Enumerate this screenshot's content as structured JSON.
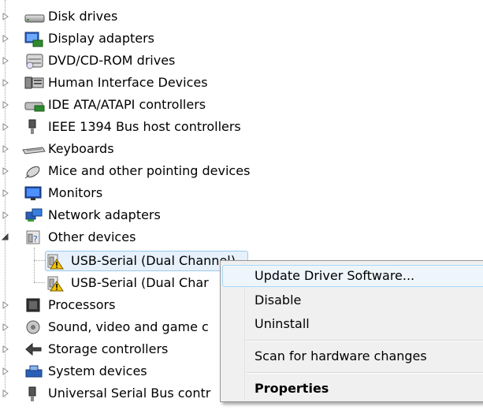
{
  "tree": {
    "items": [
      {
        "label": "Disk drives",
        "icon": "disk-drive-icon"
      },
      {
        "label": "Display adapters",
        "icon": "display-adapter-icon"
      },
      {
        "label": "DVD/CD-ROM drives",
        "icon": "dvd-drive-icon"
      },
      {
        "label": "Human Interface Devices",
        "icon": "hid-icon"
      },
      {
        "label": "IDE ATA/ATAPI controllers",
        "icon": "ide-controller-icon"
      },
      {
        "label": "IEEE 1394 Bus host controllers",
        "icon": "ieee1394-icon"
      },
      {
        "label": "Keyboards",
        "icon": "keyboard-icon"
      },
      {
        "label": "Mice and other pointing devices",
        "icon": "mouse-icon"
      },
      {
        "label": "Monitors",
        "icon": "monitor-icon"
      },
      {
        "label": "Network adapters",
        "icon": "network-adapter-icon"
      },
      {
        "label": "Other devices",
        "icon": "other-devices-icon"
      },
      {
        "label": "Processors",
        "icon": "processor-icon"
      },
      {
        "label": "Sound, video and game c",
        "icon": "sound-icon"
      },
      {
        "label": "Storage controllers",
        "icon": "storage-controller-icon"
      },
      {
        "label": "System devices",
        "icon": "system-devices-icon"
      },
      {
        "label": "Universal Serial Bus contr",
        "icon": "usb-icon"
      }
    ],
    "other_devices_children": [
      {
        "label": "USB-Serial (Dual Channel)",
        "icon": "unknown-device-warning-icon"
      },
      {
        "label": "USB-Serial (Dual Char",
        "icon": "unknown-device-warning-icon"
      }
    ]
  },
  "context_menu": {
    "items": [
      {
        "label": "Update Driver Software..."
      },
      {
        "label": "Disable"
      },
      {
        "label": "Uninstall"
      },
      {
        "label": "Scan for hardware changes"
      },
      {
        "label": "Properties"
      }
    ]
  }
}
